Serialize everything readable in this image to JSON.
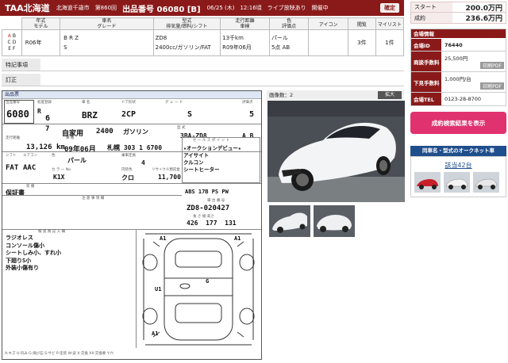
{
  "topbar": {
    "venue": "TAA北海道",
    "location": "北海道千歳市",
    "session": "第860回",
    "lot_label": "出品番号",
    "lot_no": "06080",
    "lot_grade": "[B]",
    "date": "06/25 (木)",
    "time": "12:16頃",
    "live": "ライブ放映あり",
    "status": "開催中",
    "confirm": "確定"
  },
  "table": {
    "headers": [
      "年式\nモデル",
      "車名\nグレード",
      "型式\n排気量/燃料/シフト",
      "走行距離\n車検",
      "色\n評価点",
      "アイコン",
      "閲覧",
      "マイリスト"
    ],
    "year": "R06年",
    "name": "B R Z",
    "grade": "S",
    "model": "ZD8",
    "engine": "2400cc/ガソリン/FAT",
    "mileage": "13千km",
    "inspection": "R09年06月",
    "color": "パール",
    "score": "5点 AB",
    "views": "3件",
    "mylist": "1件",
    "grade_letters": [
      "A",
      "B",
      "C",
      "D",
      "E",
      "F"
    ]
  },
  "labels": {
    "tokki": "特記事項",
    "teisei": "訂正"
  },
  "sheet": {
    "title": "出品票",
    "lot": "6080",
    "era": "R",
    "year_no": "6",
    "month": "7",
    "name": "BRZ",
    "doors": "2CP",
    "grade": "S",
    "score": "5",
    "mileage": "13,126",
    "km": "km",
    "insp_m": "09",
    "insp_d": "06",
    "region": "札幌",
    "plate": "303",
    "plate2": "1 6700",
    "owner": "自家用",
    "cc": "2400",
    "fuel": "ガソリン",
    "model_code": "3BA-ZD8",
    "int_score_a": "A",
    "int_score_b": "B",
    "shift": "FAT",
    "ac": "AAC",
    "color": "パール",
    "color_no": "K1X",
    "seats": "4",
    "int_color": "クロ",
    "price": "11,700",
    "sales_points": [
      "★オークションデビュー★",
      "アイサイト",
      "クルコン",
      "シートヒーター"
    ],
    "equip": "ABS 17B PS PW",
    "warranty": "保証書",
    "chassis": "ZD8-020427",
    "dims": "426  177  131",
    "remarks": [
      "ラジオレス",
      "コンソール傷小",
      "シートしみ小、すれ小",
      "下廻りS小",
      "外装小傷有り"
    ],
    "diag": [
      "A1",
      "A1",
      "U1",
      "G",
      "A1"
    ],
    "hdr_labels": {
      "lot": "出品番号",
      "era": "初度登録",
      "name": "車 名",
      "door": "ドア形状",
      "grade": "グ レ ー ド",
      "score": "評価点",
      "mile": "走行距離",
      "insp": "車 検",
      "region": "登 録 番 号",
      "use": "用途",
      "cc": "排気量",
      "fuel": "燃料",
      "model": "型 式",
      "shift": "シフト",
      "ac": "エアコン",
      "color": "色",
      "cno": "カ ラ ー No.",
      "seats": "乗車定員",
      "icol": "内装色",
      "price": "リサイクル預託金",
      "sales": "セ ー ル ス ポ イ ン ト",
      "equip": "装 備",
      "notes": "注 意 事 項 欄",
      "remark": "検 査 員 記 入 欄",
      "vin": "車 台 番 号",
      "dim": "長 さ  幅  高さ"
    }
  },
  "photos": {
    "label": "画像数：2",
    "btn": "拡大"
  },
  "right": {
    "start_k": "スタート",
    "start_v": "200.0万円",
    "sold_k": "成約",
    "sold_v": "236.6万円",
    "info_title": "会場情報",
    "id_k": "会場ID",
    "id_v": "76440",
    "fee_k": "商談手数料",
    "fee_v": "25,500円",
    "sub_k": "下見手数料",
    "sub_v": "1,000円/台",
    "tel_k": "会場TEL",
    "tel_v": "0123-28-8700",
    "pdf": "印刷PDF",
    "btn": "成約検索結果を表示",
    "same": "同車名・型式のオークネット車",
    "count": "該当42台"
  },
  "bottom_note": "A:キズ  U:凹み  G:飛び石  S:サビ  P:塗装  W:波  X:交換  XX:交換要  Y:穴"
}
